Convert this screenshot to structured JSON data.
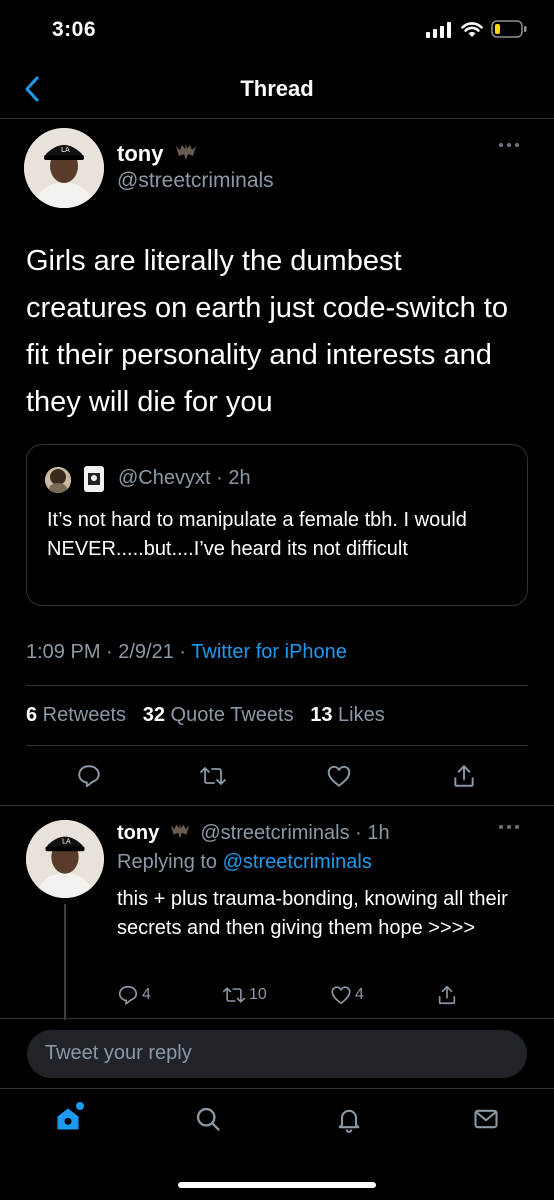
{
  "status_bar": {
    "time": "3:06"
  },
  "header": {
    "title": "Thread"
  },
  "main_tweet": {
    "name": "tony",
    "handle": "@streetcriminals",
    "text": "Girls are literally the dumbest creatures on earth just code-switch to fit their personality and interests and they will die for you",
    "quote": {
      "meta": "@Chevyxt · 2h",
      "text": "It’s not hard to manipulate a female tbh. I would NEVER.....but....I’ve heard its not difficult"
    },
    "time": "1:09 PM · 2/9/21 · ",
    "source": "Twitter for iPhone",
    "retweets": "6",
    "retweets_label": " Retweets",
    "quote_tweets": "32",
    "quote_tweets_label": " Quote Tweets",
    "likes": "13",
    "likes_label": " Likes"
  },
  "reply": {
    "name": "tony",
    "handle_time": "@streetcriminals · 1h",
    "replying_label": "Replying to ",
    "replying_to": "@streetcriminals",
    "text": "this + plus trauma-bonding, knowing all their secrets and then giving them hope >>>>",
    "replies": "4",
    "retweets": "10",
    "likes": "4"
  },
  "reply_box": {
    "placeholder": "Tweet your reply"
  },
  "icons": {
    "reply": "reply-icon",
    "retweet": "retweet-icon",
    "like": "heart-icon",
    "share": "share-icon",
    "home": "home-icon",
    "search": "search-icon",
    "notifications": "bell-icon",
    "messages": "mail-icon"
  },
  "colors": {
    "accent": "#1d9bf0",
    "background": "#000000",
    "muted": "#8b98a5",
    "divider": "#2f3336"
  }
}
